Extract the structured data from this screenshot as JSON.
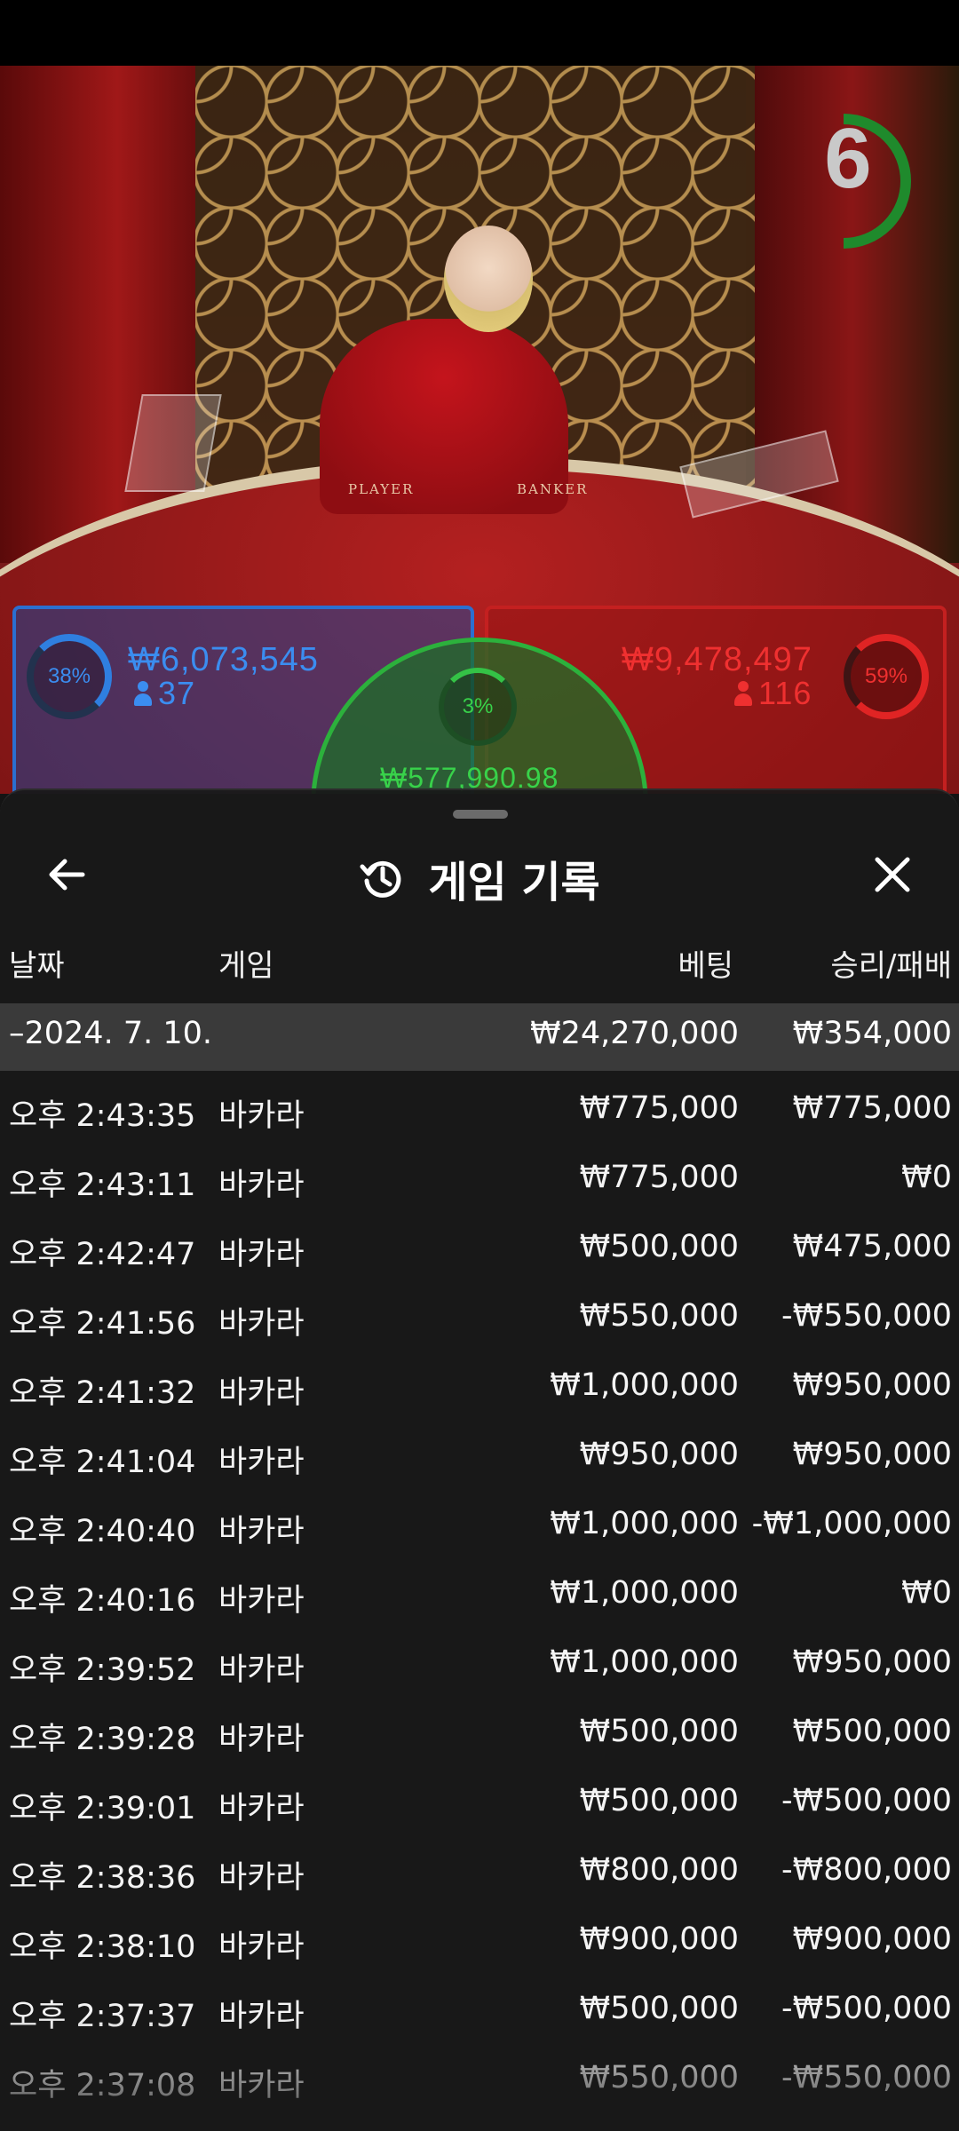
{
  "stream": {
    "timer": "6",
    "table_labels": {
      "player": "PLAYER",
      "banker": "BANKER"
    },
    "player": {
      "percent": "38%",
      "amount": "₩6,073,545",
      "count": "37"
    },
    "tie": {
      "percent": "3%",
      "amount": "₩577,990.98"
    },
    "banker": {
      "percent": "59%",
      "amount": "₩9,478,497",
      "count": "116"
    },
    "colors": {
      "player": "#2f7fe0",
      "banker": "#e02424",
      "tie": "#34c246"
    }
  },
  "sheet": {
    "title": "게임 기록",
    "icons": {
      "back": "arrow-left-icon",
      "history": "history-icon",
      "close": "close-icon"
    },
    "columns": {
      "date": "날짜",
      "game": "게임",
      "bet": "베팅",
      "result": "승리/패배"
    },
    "date_group": {
      "date": "–2024. 7. 10.",
      "bet_total": "₩24,270,000",
      "result_total": "₩354,000"
    },
    "rows": [
      {
        "time": "오후 2:43:35",
        "game": "바카라",
        "bet": "₩775,000",
        "result": "₩775,000"
      },
      {
        "time": "오후 2:43:11",
        "game": "바카라",
        "bet": "₩775,000",
        "result": "₩0"
      },
      {
        "time": "오후 2:42:47",
        "game": "바카라",
        "bet": "₩500,000",
        "result": "₩475,000"
      },
      {
        "time": "오후 2:41:56",
        "game": "바카라",
        "bet": "₩550,000",
        "result": "-₩550,000"
      },
      {
        "time": "오후 2:41:32",
        "game": "바카라",
        "bet": "₩1,000,000",
        "result": "₩950,000"
      },
      {
        "time": "오후 2:41:04",
        "game": "바카라",
        "bet": "₩950,000",
        "result": "₩950,000"
      },
      {
        "time": "오후 2:40:40",
        "game": "바카라",
        "bet": "₩1,000,000",
        "result": "-₩1,000,000"
      },
      {
        "time": "오후 2:40:16",
        "game": "바카라",
        "bet": "₩1,000,000",
        "result": "₩0"
      },
      {
        "time": "오후 2:39:52",
        "game": "바카라",
        "bet": "₩1,000,000",
        "result": "₩950,000"
      },
      {
        "time": "오후 2:39:28",
        "game": "바카라",
        "bet": "₩500,000",
        "result": "₩500,000"
      },
      {
        "time": "오후 2:39:01",
        "game": "바카라",
        "bet": "₩500,000",
        "result": "-₩500,000"
      },
      {
        "time": "오후 2:38:36",
        "game": "바카라",
        "bet": "₩800,000",
        "result": "-₩800,000"
      },
      {
        "time": "오후 2:38:10",
        "game": "바카라",
        "bet": "₩900,000",
        "result": "₩900,000"
      },
      {
        "time": "오후 2:37:37",
        "game": "바카라",
        "bet": "₩500,000",
        "result": "-₩500,000"
      },
      {
        "time": "오후 2:37:08",
        "game": "바카라",
        "bet": "₩550,000",
        "result": "-₩550,000"
      }
    ]
  }
}
